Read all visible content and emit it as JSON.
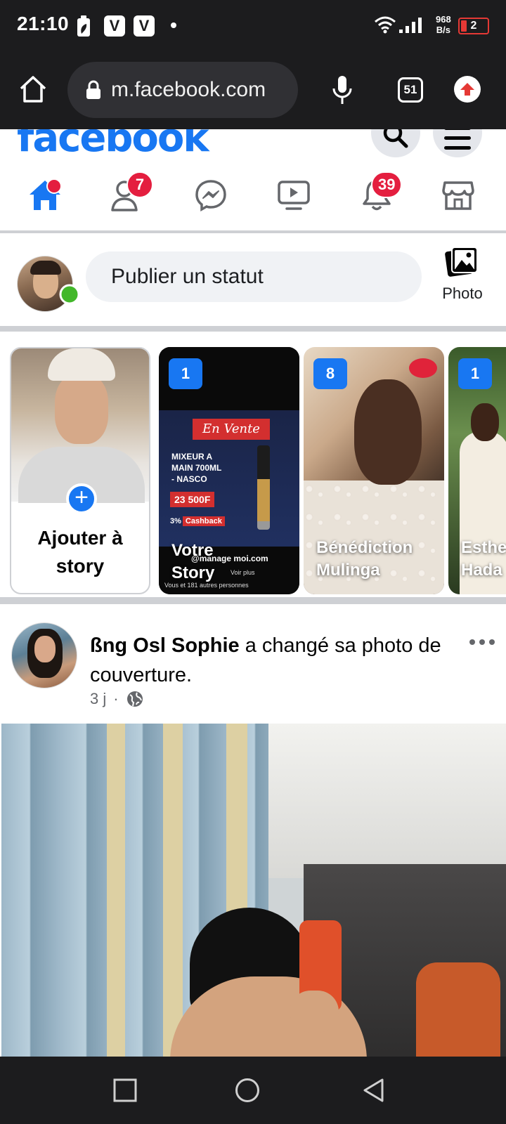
{
  "status_bar": {
    "time": "21:10",
    "notif_app_letter": "V",
    "net_speed_value": "968",
    "net_speed_unit": "B/s",
    "battery_level": "2",
    "battery_color": "#e53935"
  },
  "browser": {
    "url": "m.facebook.com",
    "tab_count": "51"
  },
  "facebook": {
    "logo": "facebook",
    "brand_color": "#1877f2",
    "nav": {
      "friends_badge": "7",
      "notifications_badge": "39"
    },
    "composer": {
      "placeholder": "Publier un statut",
      "photo_label": "Photo"
    },
    "stories": [
      {
        "label": "Ajouter à story",
        "type": "create"
      },
      {
        "count": "1",
        "name": "Votre Story",
        "type": "ad",
        "ad_banner": "En Vente",
        "ad_lines": [
          "MIXEUR A",
          "MAIN 700ML",
          "- NASCO"
        ],
        "ad_price": "23 500F",
        "ad_cash_prefix": "3%",
        "ad_cash_tag": "Cashback",
        "ad_site": "@manage moi.com",
        "ad_more": "Voir plus",
        "ad_viewers": "Vous et 181 autres personnes"
      },
      {
        "count": "8",
        "name": "Bénédiction Mulinga"
      },
      {
        "count": "1",
        "name": "Esther Hada"
      }
    ],
    "post": {
      "author": "ßng Osl Sophie",
      "action": " a changé sa photo de couverture.",
      "time": "3 j",
      "separator": "·",
      "privacy_icon": "globe-icon"
    }
  }
}
